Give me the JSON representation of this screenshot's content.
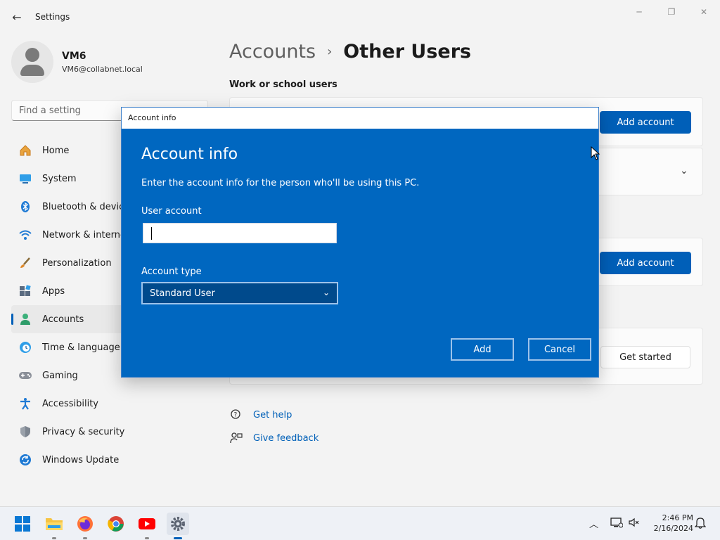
{
  "window": {
    "title": "Settings",
    "back_icon": "back-arrow-icon",
    "minimize": "─",
    "maximize": "❐",
    "close": "✕"
  },
  "profile": {
    "name": "VM6",
    "email": "VM6@collabnet.local"
  },
  "search": {
    "placeholder": "Find a setting"
  },
  "nav": {
    "items": [
      {
        "label": "Home",
        "icon": "home-icon"
      },
      {
        "label": "System",
        "icon": "system-icon"
      },
      {
        "label": "Bluetooth & devices",
        "icon": "bluetooth-icon"
      },
      {
        "label": "Network & internet",
        "icon": "wifi-icon"
      },
      {
        "label": "Personalization",
        "icon": "brush-icon"
      },
      {
        "label": "Apps",
        "icon": "apps-icon"
      },
      {
        "label": "Accounts",
        "icon": "accounts-icon",
        "active": true
      },
      {
        "label": "Time & language",
        "icon": "clock-globe-icon"
      },
      {
        "label": "Gaming",
        "icon": "gamepad-icon"
      },
      {
        "label": "Accessibility",
        "icon": "accessibility-icon"
      },
      {
        "label": "Privacy & security",
        "icon": "shield-icon"
      },
      {
        "label": "Windows Update",
        "icon": "update-icon"
      }
    ]
  },
  "main": {
    "breadcrumb_parent": "Accounts",
    "breadcrumb_sep": "›",
    "breadcrumb_current": "Other Users",
    "section_title": "Work or school users",
    "add_account_1": "Add account",
    "add_account_2": "Add account",
    "get_started": "Get started",
    "help": "Get help",
    "feedback": "Give feedback"
  },
  "dialog": {
    "window_title": "Account info",
    "heading": "Account info",
    "description": "Enter the account info for the person who'll be using this PC.",
    "user_account_label": "User account",
    "user_account_value": "",
    "account_type_label": "Account type",
    "account_type_value": "Standard User",
    "add_button": "Add",
    "cancel_button": "Cancel"
  },
  "taskbar": {
    "time": "2:46 PM",
    "date": "2/16/2024"
  },
  "colors": {
    "accent": "#005fb8",
    "dialog_bg": "#0067c0"
  }
}
